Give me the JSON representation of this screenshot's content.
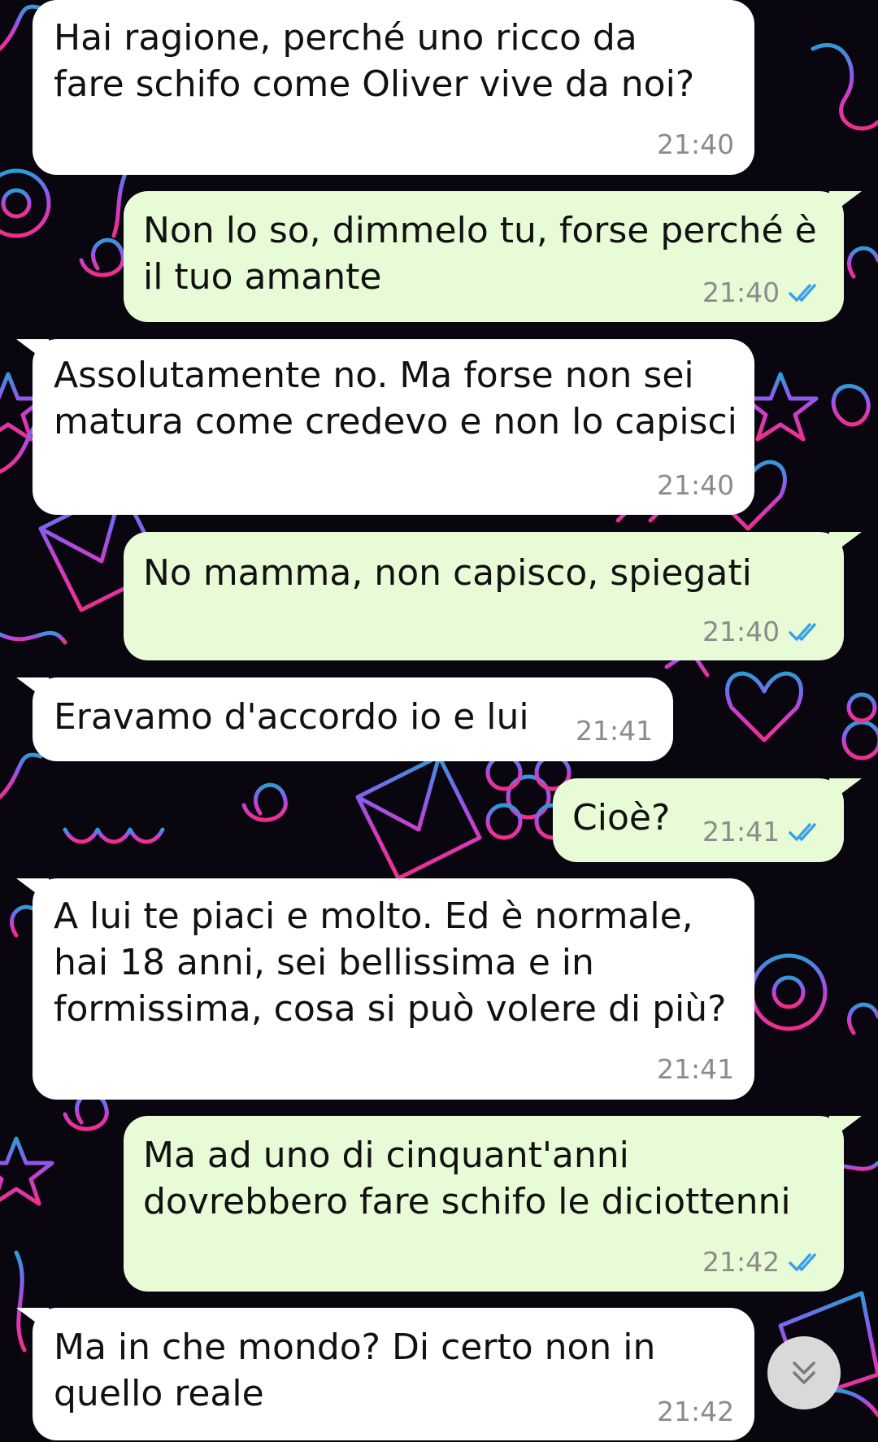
{
  "colors": {
    "incoming_bubble": "#ffffff",
    "outgoing_bubble": "#e8fbd7",
    "timestamp": "#8b8b8b",
    "read_ticks": "#3aa0e8",
    "wallpaper_base": "#0a0610"
  },
  "messages": [
    {
      "direction": "incoming",
      "text": "Hai ragione, perché uno ricco da\nfare schifo come Oliver vive da noi?",
      "time": "21:40"
    },
    {
      "direction": "outgoing",
      "text": "Non lo so, dimmelo tu, forse perché è\nil tuo amante",
      "time": "21:40",
      "status_icon": "double-check-read-icon"
    },
    {
      "direction": "incoming",
      "text": "Assolutamente no. Ma forse non sei\nmatura come credevo e non lo capisci",
      "time": "21:40"
    },
    {
      "direction": "outgoing",
      "text": "No mamma, non capisco, spiegati",
      "time": "21:40",
      "status_icon": "double-check-read-icon"
    },
    {
      "direction": "incoming",
      "text": "Eravamo d'accordo io e lui",
      "time": "21:41"
    },
    {
      "direction": "outgoing",
      "text": "Cioè?",
      "time": "21:41",
      "status_icon": "double-check-read-icon"
    },
    {
      "direction": "incoming",
      "text": "A lui te piaci e molto. Ed è normale,\nhai 18 anni, sei bellissima e in\nformissima, cosa si può volere di più?",
      "time": "21:41"
    },
    {
      "direction": "outgoing",
      "text": "Ma ad uno di cinquant'anni\ndovrebbero fare schifo le diciottenni",
      "time": "21:42",
      "status_icon": "double-check-read-icon"
    },
    {
      "direction": "incoming",
      "text": "Ma in che mondo? Di certo non in\nquello reale",
      "time": "21:42"
    }
  ],
  "scroll_button": {
    "icon": "double-chevron-down-icon"
  },
  "wallpaper": {
    "icons": [
      "envelope-icon",
      "heart-icon",
      "star-icon",
      "at-sign-icon",
      "flower-icon",
      "swirl-icon"
    ]
  }
}
